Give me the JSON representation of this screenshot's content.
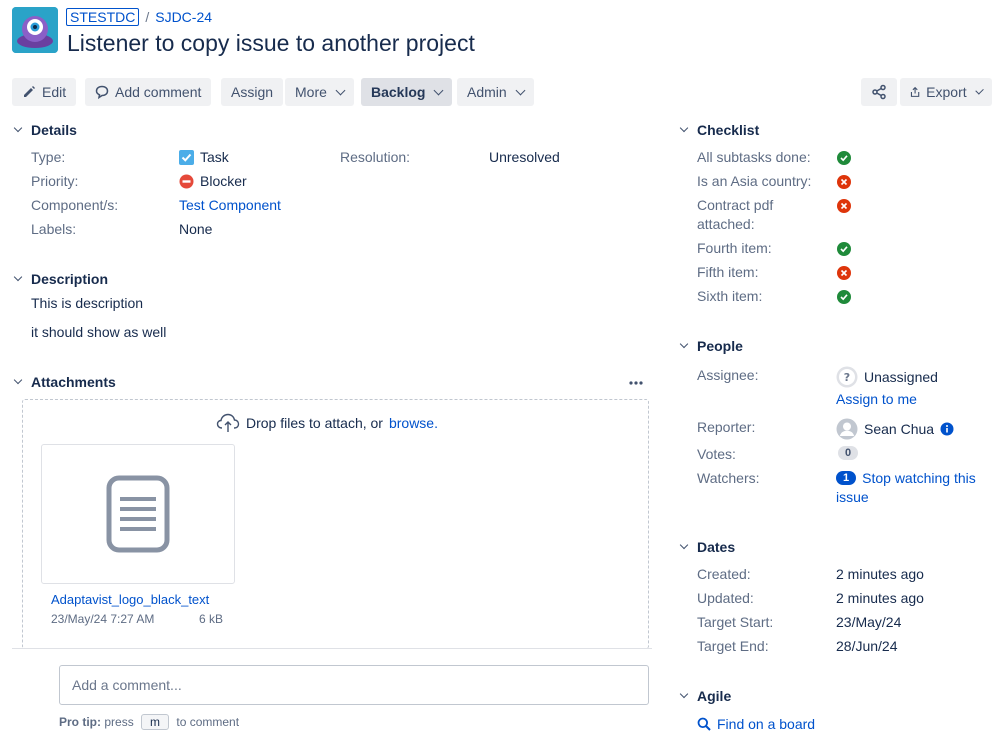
{
  "breadcrumb": {
    "project": "STESTDC",
    "separator": "/",
    "issue_key": "SJDC-24"
  },
  "issue_title": "Listener to copy issue to another project",
  "toolbar": {
    "edit": "Edit",
    "add_comment": "Add comment",
    "assign": "Assign",
    "more": "More",
    "status": "Backlog",
    "admin": "Admin",
    "export": "Export"
  },
  "details": {
    "heading": "Details",
    "type_label": "Type:",
    "type_value": "Task",
    "priority_label": "Priority:",
    "priority_value": "Blocker",
    "components_label": "Component/s:",
    "components_value": "Test Component",
    "labels_label": "Labels:",
    "labels_value": "None",
    "resolution_label": "Resolution:",
    "resolution_value": "Unresolved"
  },
  "description": {
    "heading": "Description",
    "line1": "This is description",
    "line2": "it should show as well"
  },
  "attachments": {
    "heading": "Attachments",
    "drop_text": "Drop files to attach, or",
    "browse": "browse.",
    "file_name": "Adaptavist_logo_black_text",
    "file_date": "23/May/24 7:27 AM",
    "file_size": "6 kB"
  },
  "comment": {
    "placeholder": "Add a comment...",
    "tip_prefix": "Pro tip:",
    "tip_press": "press",
    "tip_key": "m",
    "tip_suffix": "to comment"
  },
  "checklist": {
    "heading": "Checklist",
    "items": [
      {
        "label": "All subtasks done:",
        "status": "ok"
      },
      {
        "label": "Is an Asia country:",
        "status": "bad"
      },
      {
        "label": "Contract pdf",
        "label2": "attached:",
        "status": "bad"
      },
      {
        "label": "Fourth item:",
        "status": "ok"
      },
      {
        "label": "Fifth item:",
        "status": "bad"
      },
      {
        "label": "Sixth item:",
        "status": "ok"
      }
    ]
  },
  "people": {
    "heading": "People",
    "assignee_label": "Assignee:",
    "assignee_value": "Unassigned",
    "assign_to_me": "Assign to me",
    "reporter_label": "Reporter:",
    "reporter_value": "Sean Chua",
    "votes_label": "Votes:",
    "votes_count": "0",
    "watchers_label": "Watchers:",
    "watchers_count": "1",
    "watch_line1": "Stop watching this",
    "watch_line2": "issue"
  },
  "dates": {
    "heading": "Dates",
    "created_label": "Created:",
    "created_value": "2 minutes ago",
    "updated_label": "Updated:",
    "updated_value": "2 minutes ago",
    "target_start_label": "Target Start:",
    "target_start_value": "23/May/24",
    "target_end_label": "Target End:",
    "target_end_value": "28/Jun/24"
  },
  "agile": {
    "heading": "Agile",
    "find_board": "Find on a board"
  },
  "colors": {
    "link": "#0052cc",
    "ok": "#1f8a3a",
    "bad": "#de350b",
    "text": "#172b4d",
    "muted": "#5e6c84"
  }
}
